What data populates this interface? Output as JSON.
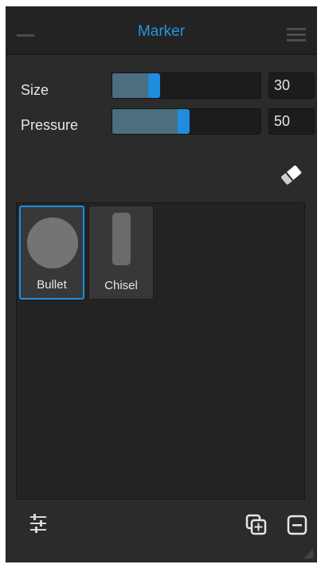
{
  "header": {
    "title": "Marker"
  },
  "controls": {
    "size": {
      "label": "Size",
      "value": "30",
      "fraction": 0.3
    },
    "pressure": {
      "label": "Pressure",
      "value": "50",
      "fraction": 0.5
    }
  },
  "presets": [
    {
      "label": "Bullet",
      "selected": true
    },
    {
      "label": "Chisel",
      "selected": false
    }
  ],
  "icons": {
    "minimize": "minimize-icon",
    "menu": "hamburger-menu-icon",
    "eraser": "eraser-icon",
    "settings": "sliders-icon",
    "add": "duplicate-add-icon",
    "remove": "remove-icon"
  },
  "colors": {
    "accent": "#1f8de0",
    "title": "#2a93e0",
    "panel_bg": "#2b2b2b",
    "fill": "#4b6f7f"
  }
}
